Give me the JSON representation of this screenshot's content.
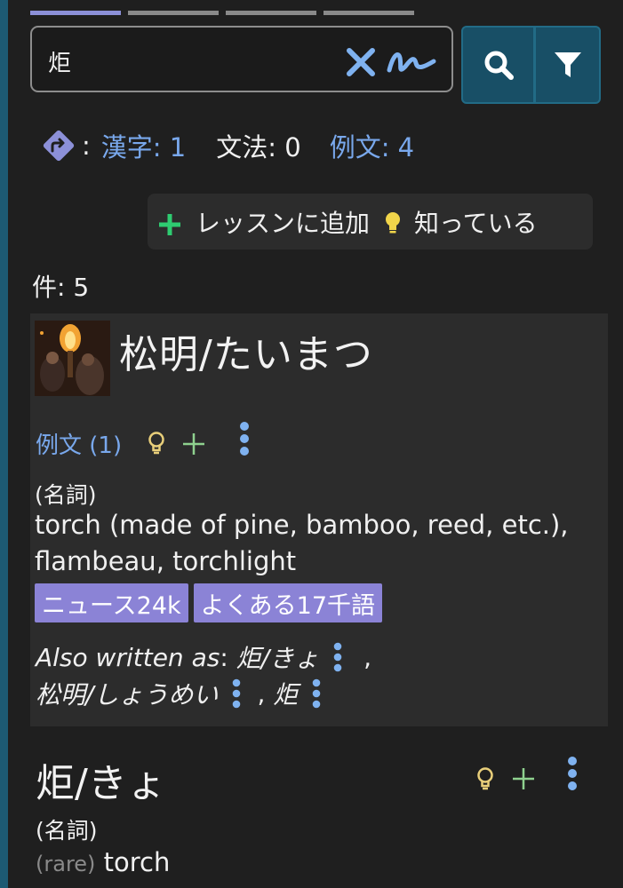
{
  "search": {
    "query": "炬"
  },
  "counts": {
    "kanji": "漢字: 1",
    "grammar": "文法: 0",
    "examples": "例文: 4"
  },
  "actions": {
    "add_lesson": "レッスンに追加",
    "known": "知っている"
  },
  "results": {
    "count_label": "件: 5"
  },
  "entries": [
    {
      "headword": "松明/たいまつ",
      "examples_link": "例文 (1)",
      "pos": "(名詞)",
      "gloss_line1": "torch (made of pine, bamboo, reed, etc.),",
      "gloss_line2": "flambeau, torchlight",
      "tags": [
        "ニュース24k",
        "よくある17千語"
      ],
      "also_label": "Also written as",
      "also_items": [
        "炬/きょ",
        "松明/しょうめい",
        "炬"
      ]
    },
    {
      "headword": "炬/きょ",
      "pos": "(名詞)",
      "note": "(rare)",
      "gloss": "torch"
    }
  ],
  "colors": {
    "accent_blue": "#79a8ec",
    "tag_purple": "#8b83d6",
    "button_teal": "#184f66",
    "plus_green": "#2ecc71",
    "bulb_yellow": "#f1d54a"
  }
}
